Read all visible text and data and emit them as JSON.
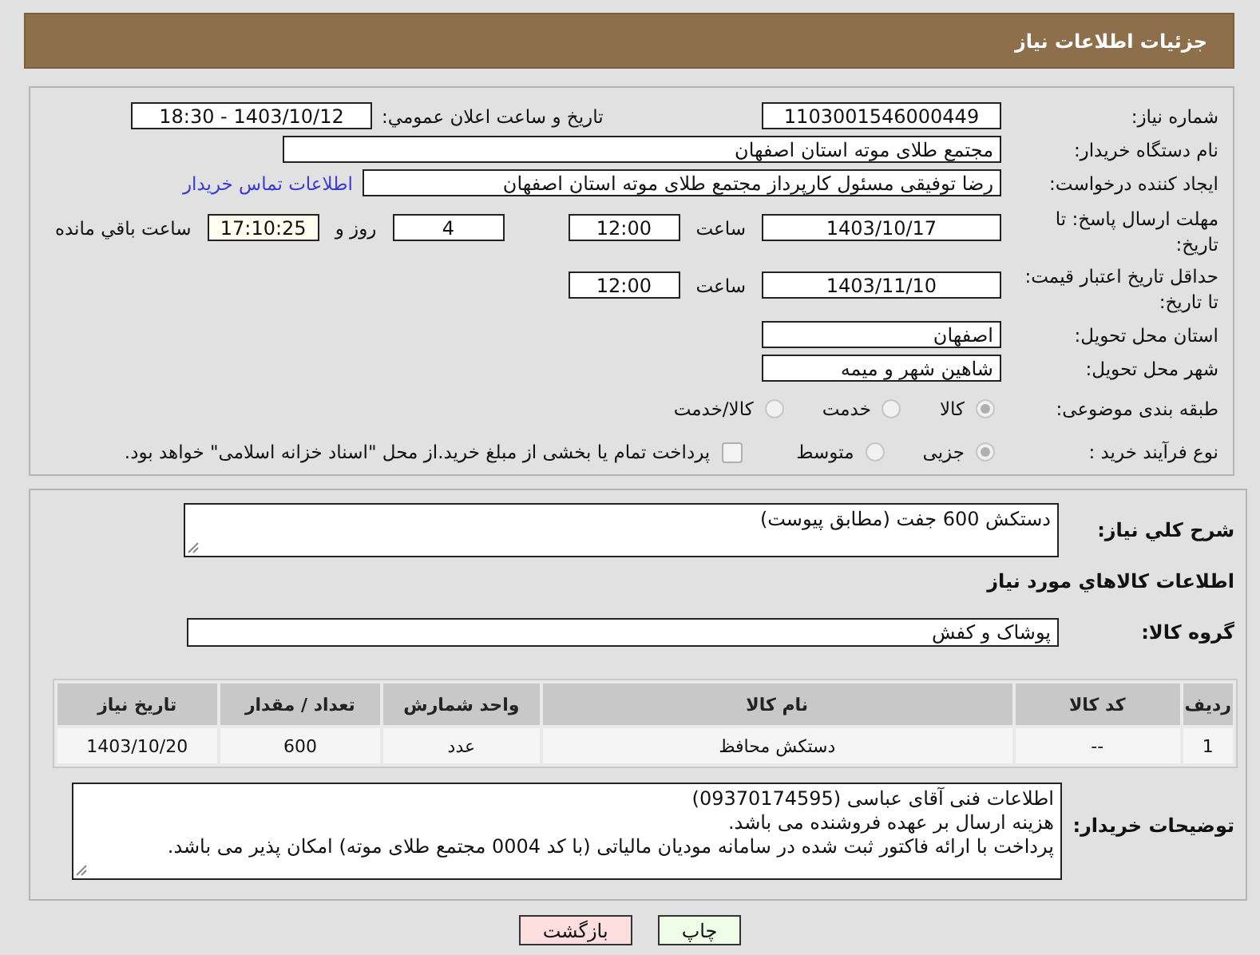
{
  "header": {
    "title": "جزئیات اطلاعات نیاز"
  },
  "need_info": {
    "need_number": {
      "label": "شماره نیاز:",
      "value": "1103001546000449"
    },
    "announcement": {
      "label": "تاریخ و ساعت اعلان عمومي:",
      "value": "1403/10/12 - 18:30"
    },
    "buyer_org": {
      "label": "نام دستگاه خریدار:",
      "value": "مجتمع طلای موته استان اصفهان"
    },
    "creator": {
      "label": "ایجاد کننده درخواست:",
      "value": "رضا توفیقی مسئول کارپرداز مجتمع طلای موته استان اصفهان",
      "link": "اطلاعات تماس خریدار"
    },
    "reply_deadline": {
      "label": "مهلت ارسال پاسخ: تا تاریخ:",
      "date": "1403/10/17",
      "time_label": "ساعت",
      "time": "12:00",
      "days": "4",
      "days_label": "روز و",
      "remaining": "17:10:25",
      "remaining_label": "ساعت باقي مانده"
    },
    "price_validity": {
      "label": "حداقل تاریخ اعتبار قیمت: تا تاریخ:",
      "date": "1403/11/10",
      "time_label": "ساعت",
      "time": "12:00"
    },
    "province": {
      "label": "استان محل تحویل:",
      "value": "اصفهان"
    },
    "city": {
      "label": "شهر محل تحویل:",
      "value": "شاهین شهر و میمه"
    },
    "category": {
      "label": "طبقه بندی موضوعی:",
      "options": [
        {
          "label": "کالا",
          "selected": true
        },
        {
          "label": "خدمت",
          "selected": false
        },
        {
          "label": "کالا/خدمت",
          "selected": false
        }
      ]
    },
    "purchase_type": {
      "label": "نوع فرآیند خرید :",
      "options": [
        {
          "label": "جزیی",
          "selected": true
        },
        {
          "label": "متوسط",
          "selected": false
        }
      ],
      "payment": {
        "label": "پرداخت تمام یا بخشی از مبلغ خرید.از محل \"اسناد خزانه اسلامی\" خواهد بود.",
        "checked": false
      }
    }
  },
  "details": {
    "description": {
      "label": "شرح کلي نياز:",
      "value": "دستکش 600 جفت (مطابق پیوست)"
    },
    "items_heading": "اطلاعات کالاهاي مورد نياز",
    "goods_group": {
      "label": "گروه کالا:",
      "value": "پوشاک و کفش"
    },
    "table": {
      "columns": [
        "ردیف",
        "کد کالا",
        "نام کالا",
        "واحد شمارش",
        "تعداد / مقدار",
        "تاریخ نیاز"
      ],
      "rows": [
        [
          "1",
          "--",
          "دستکش محافظ",
          "عدد",
          "600",
          "1403/10/20"
        ]
      ]
    },
    "buyer_notes": {
      "label": "توضیحات خریدار:",
      "value": "اطلاعات فنی آقای عباسی (09370174595)\nهزینه ارسال بر عهده فروشنده می باشد.\nپرداخت با ارائه فاکتور ثبت شده در سامانه مودیان مالیاتی (با کد 0004 مجتمع طلای موته) امکان پذیر می باشد."
    }
  },
  "buttons": [
    {
      "kind": "print",
      "label": "چاپ"
    },
    {
      "kind": "back",
      "label": "بازگشت"
    }
  ]
}
